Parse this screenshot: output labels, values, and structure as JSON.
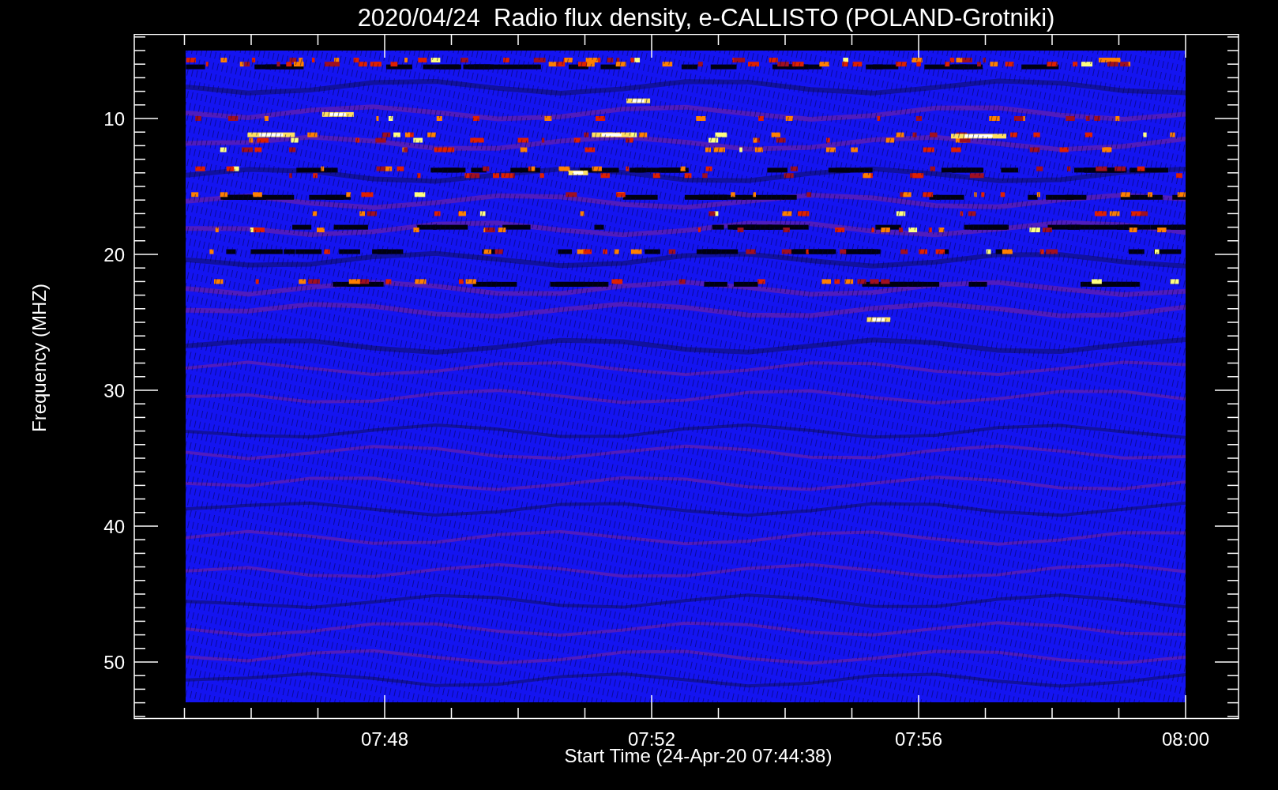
{
  "title": "2020/04/24  Radio flux density, e-CALLISTO (POLAND-Grotniki)",
  "y_axis": {
    "label": "Frequency (MHZ)",
    "ticks": [
      "10",
      "20",
      "30",
      "40",
      "50"
    ]
  },
  "x_axis": {
    "label": "Start Time (24-Apr-20 07:44:38)",
    "ticks": [
      "07:48",
      "07:52",
      "07:56",
      "08:00"
    ]
  }
}
